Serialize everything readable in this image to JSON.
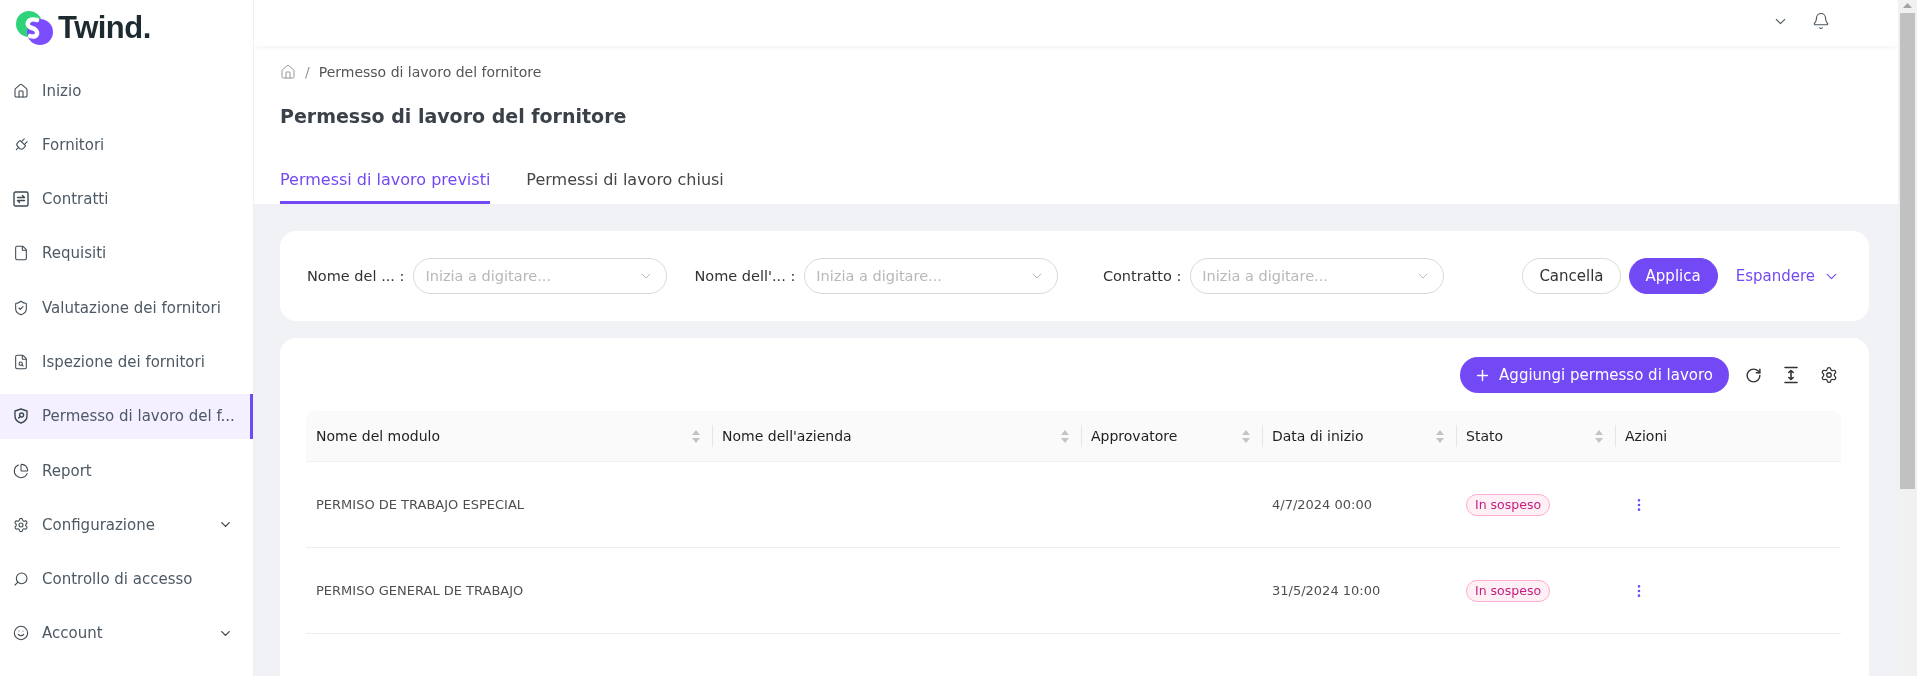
{
  "logo": {
    "text": "Twind."
  },
  "sidebar": {
    "items": [
      {
        "label": "Inizio",
        "kind": "link",
        "selected": false
      },
      {
        "label": "Fornitori",
        "kind": "link",
        "selected": false
      },
      {
        "label": "Contratti",
        "kind": "link",
        "selected": false
      },
      {
        "label": "Requisiti",
        "kind": "link",
        "selected": false
      },
      {
        "label": "Valutazione dei fornitori",
        "kind": "link",
        "selected": false
      },
      {
        "label": "Ispezione dei fornitori",
        "kind": "link",
        "selected": false
      },
      {
        "label": "Permesso di lavoro del f...",
        "kind": "link",
        "selected": true
      },
      {
        "label": "Report",
        "kind": "link",
        "selected": false
      },
      {
        "label": "Configurazione",
        "kind": "group",
        "expanded": false,
        "selected": false
      },
      {
        "label": "Controllo di accesso",
        "kind": "link",
        "selected": false
      },
      {
        "label": "Account",
        "kind": "group",
        "expanded": false,
        "selected": false
      }
    ]
  },
  "breadcrumb": {
    "separator": "/",
    "items": [
      "Permesso di lavoro del fornitore"
    ]
  },
  "page_title": "Permesso di lavoro del fornitore",
  "tabs": [
    {
      "label": "Permessi di lavoro previsti",
      "selected": true
    },
    {
      "label": "Permessi di lavoro chiusi",
      "selected": false
    }
  ],
  "filters": {
    "fields": [
      {
        "label": "Nome del ... :",
        "placeholder": "Inizia a digitare..."
      },
      {
        "label": "Nome dell'... :",
        "placeholder": "Inizia a digitare..."
      },
      {
        "label": "Contratto :",
        "placeholder": "Inizia a digitare..."
      }
    ],
    "buttons": [
      {
        "kind": "default",
        "label": "Cancella"
      },
      {
        "kind": "primary",
        "label": "Applica"
      },
      {
        "kind": "link",
        "label": "Espandere"
      }
    ]
  },
  "table": {
    "add_button": "Aggiungi permesso di lavoro",
    "columns": [
      {
        "label": "Nome del modulo",
        "sortable": true
      },
      {
        "label": "Nome dell'azienda",
        "sortable": true
      },
      {
        "label": "Approvatore",
        "sortable": true
      },
      {
        "label": "Data di inizio",
        "sortable": true
      },
      {
        "label": "Stato",
        "sortable": true
      },
      {
        "label": "Azioni",
        "sortable": false
      }
    ],
    "rows": [
      {
        "module": "PERMISO DE TRABAJO ESPECIAL",
        "start_date": "4/7/2024 00:00",
        "status": "In sospeso"
      },
      {
        "module": "PERMISO GENERAL DE TRABAJO",
        "start_date": "31/5/2024 10:00",
        "status": "In sospeso"
      }
    ]
  }
}
